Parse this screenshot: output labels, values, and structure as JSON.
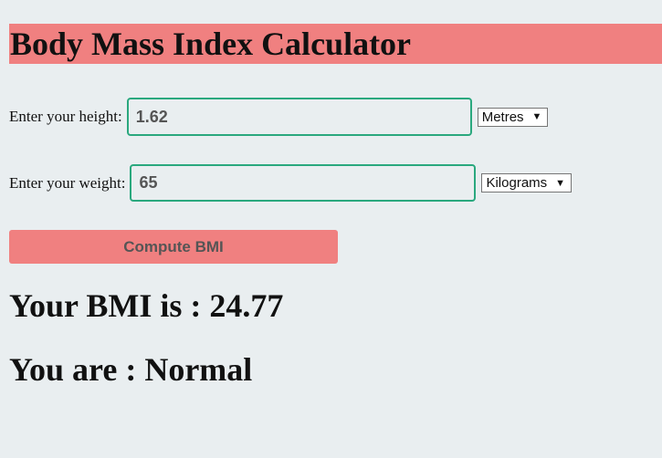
{
  "header": {
    "title": "Body Mass Index Calculator"
  },
  "height": {
    "label": "Enter your height:",
    "value": "1.62",
    "unit": "Metres"
  },
  "weight": {
    "label": "Enter your weight:",
    "value": "65",
    "unit": "Kilograms"
  },
  "compute_button": {
    "label": "Compute BMI"
  },
  "results": {
    "bmi_text": "Your BMI is : 24.77",
    "category_text": "You are : Normal"
  },
  "colors": {
    "page_background": "#e9eef0",
    "accent": "#f08080",
    "input_border": "#2aa87e"
  },
  "icons": {
    "dropdown": "chevron-down-icon"
  }
}
